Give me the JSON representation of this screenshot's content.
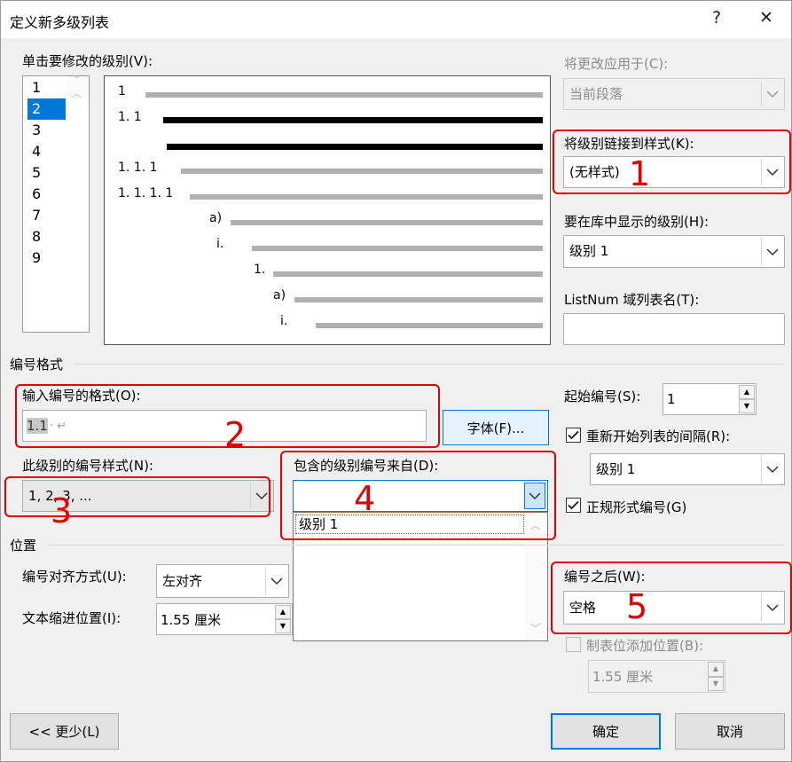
{
  "window": {
    "title": "定义新多级列表",
    "help": "?",
    "close": "✕"
  },
  "levels_list": {
    "label": "单击要修改的级别(V):",
    "items": [
      "1",
      "2",
      "3",
      "4",
      "5",
      "6",
      "7",
      "8",
      "9"
    ],
    "selected": "2"
  },
  "preview": {
    "numbers": [
      "1",
      "1. 1",
      "1. 1. 1",
      "1. 1. 1. 1",
      "a)",
      "i.",
      "1.",
      "a)",
      "i."
    ]
  },
  "apply_to": {
    "label": "将更改应用于(C):",
    "value": "当前段落"
  },
  "link_style": {
    "label": "将级别链接到样式(K):",
    "value": "(无样式)"
  },
  "gallery_level": {
    "label": "要在库中显示的级别(H):",
    "value": "级别 1"
  },
  "listnum": {
    "label": "ListNum 域列表名(T):",
    "value": ""
  },
  "number_format_section": "编号格式",
  "enter_format": {
    "label": "输入编号的格式(O):",
    "value": "1.1",
    "suffix": "· ↵"
  },
  "font_button": "字体(F)...",
  "start_at": {
    "label": "起始编号(S):",
    "value": "1"
  },
  "restart_list": {
    "label": "重新开始列表的间隔(R):",
    "checked": true,
    "value": "级别 1"
  },
  "number_style": {
    "label": "此级别的编号样式(N):",
    "value": "1, 2, 3, ..."
  },
  "include_level": {
    "label": "包含的级别编号来自(D):",
    "value": "",
    "options": [
      "级别 1"
    ]
  },
  "legal_style": {
    "label": "正规形式编号(G)",
    "checked": true
  },
  "position_section": "位置",
  "alignment": {
    "label": "编号对齐方式(U):",
    "value": "左对齐"
  },
  "text_indent": {
    "label": "文本缩进位置(I):",
    "value": "1.55 厘米"
  },
  "follow_number": {
    "label": "编号之后(W):",
    "value": "空格"
  },
  "tab_stop": {
    "label": "制表位添加位置(B):",
    "checked": false,
    "value": "1.55 厘米"
  },
  "buttons": {
    "less": "<< 更少(L)",
    "ok": "确定",
    "cancel": "取消"
  },
  "annotations": [
    "1",
    "2",
    "3",
    "4",
    "5"
  ],
  "colors": {
    "accent": "#0078d7",
    "annotation": "#e00000",
    "dialog_bg": "#f0f0f0"
  }
}
